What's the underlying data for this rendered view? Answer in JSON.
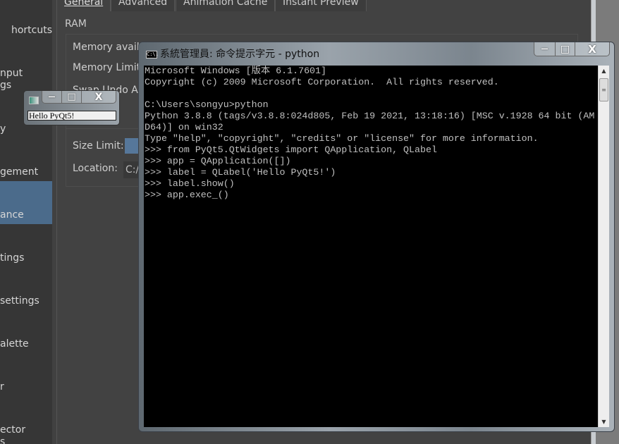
{
  "sidebar": {
    "items": [
      {
        "label": "hortcuts"
      },
      {
        "label": "nput",
        "label2": "gs"
      },
      {
        "label": "y"
      },
      {
        "label": "gement"
      },
      {
        "label": "ance"
      },
      {
        "label": "tings"
      },
      {
        "label": "settings"
      },
      {
        "label": "alette"
      },
      {
        "label": "r"
      },
      {
        "label": "ector",
        "label2": "s"
      }
    ],
    "selected_index": 4
  },
  "tabs": [
    {
      "label": "General"
    },
    {
      "label": "Advanced"
    },
    {
      "label": "Animation Cache"
    },
    {
      "label": "Instant Preview"
    }
  ],
  "ram": {
    "heading": "RAM",
    "memory_available": "Memory avail",
    "memory_limit": "Memory Limit",
    "undo": "Swap Undo A",
    "size_limit": "Size Limit:",
    "location": "Location:",
    "location_value": "C:/"
  },
  "cmd": {
    "title": "系統管理員: 命令提示字元 - python",
    "icon": "C:\\.",
    "lines": [
      "Microsoft Windows [版本 6.1.7601]",
      "Copyright (c) 2009 Microsoft Corporation.  All rights reserved.",
      "",
      "C:\\Users\\songyu>python",
      "Python 3.8.8 (tags/v3.8.8:024d805, Feb 19 2021, 13:18:16) [MSC v.1928 64 bit (AM",
      "D64)] on win32",
      "Type \"help\", \"copyright\", \"credits\" or \"license\" for more information.",
      ">>> from PyQt5.QtWidgets import QApplication, QLabel",
      ">>> app = QApplication([])",
      ">>> label = QLabel('Hello PyQt5!')",
      ">>> label.show()",
      ">>> app.exec_()"
    ]
  },
  "qt_window": {
    "label": "Hello PyQt5!"
  },
  "buttons": {
    "minimize": "—",
    "maximize": "□",
    "close": "X"
  }
}
